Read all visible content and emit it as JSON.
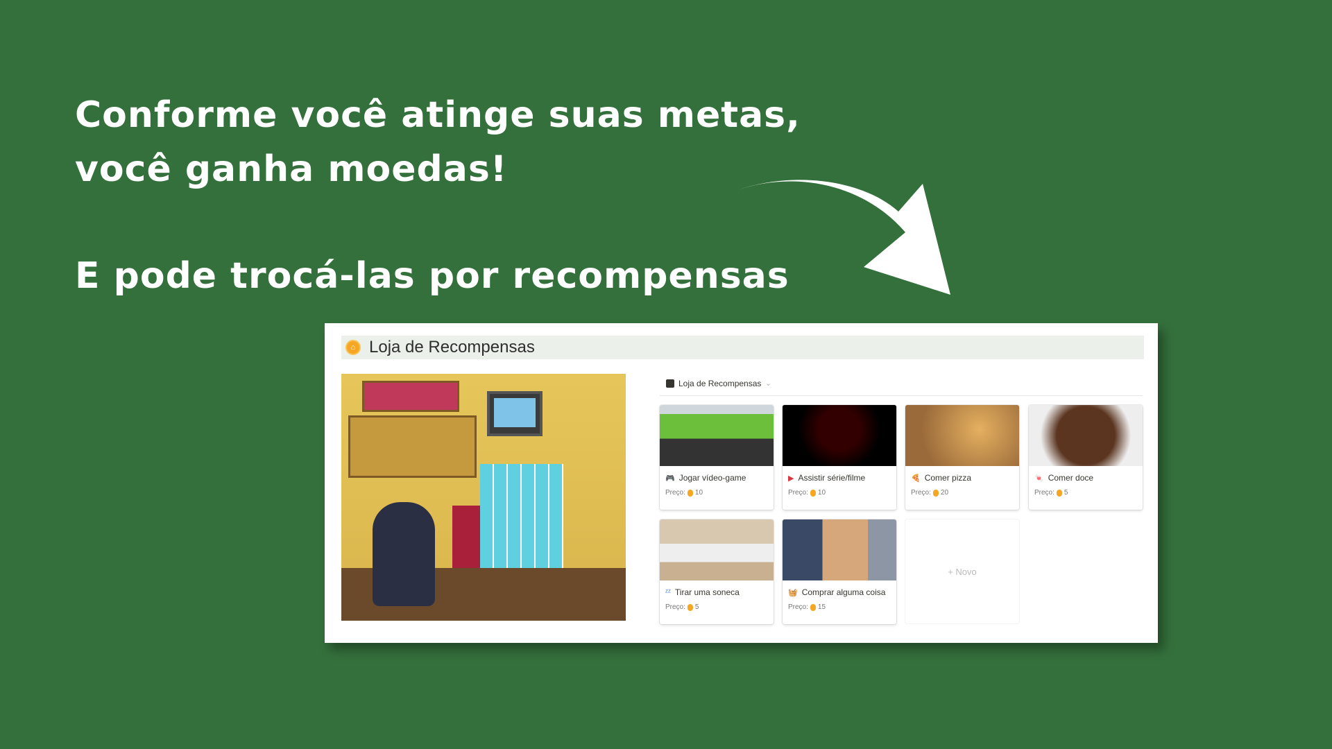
{
  "headline": {
    "line1": "Conforme você atinge suas metas,",
    "line2": "você ganha moedas!",
    "line3": "E pode trocá-las por recompensas"
  },
  "page": {
    "title": "Loja de Recompensas",
    "icon": "coin-icon"
  },
  "database": {
    "title": "Loja de Recompensas",
    "icon": "store-icon",
    "new_label": "+ Novo"
  },
  "price_label": "Preço:",
  "items": [
    {
      "name": "Jogar vídeo-game",
      "price": "10",
      "icon": "🎮",
      "color": "#8b6bb5"
    },
    {
      "name": "Assistir série/filme",
      "price": "10",
      "icon": "▶",
      "color": "#d9363e"
    },
    {
      "name": "Comer pizza",
      "price": "20",
      "icon": "🍕",
      "color": "#e59a1e"
    },
    {
      "name": "Comer doce",
      "price": "5",
      "icon": "🍬",
      "color": "#a0522d"
    },
    {
      "name": "Tirar uma soneca",
      "price": "5",
      "icon": "ᶻᶻ",
      "color": "#3a7bd5"
    },
    {
      "name": "Comprar alguma coisa",
      "price": "15",
      "icon": "🧺",
      "color": "#2e8b57"
    }
  ]
}
